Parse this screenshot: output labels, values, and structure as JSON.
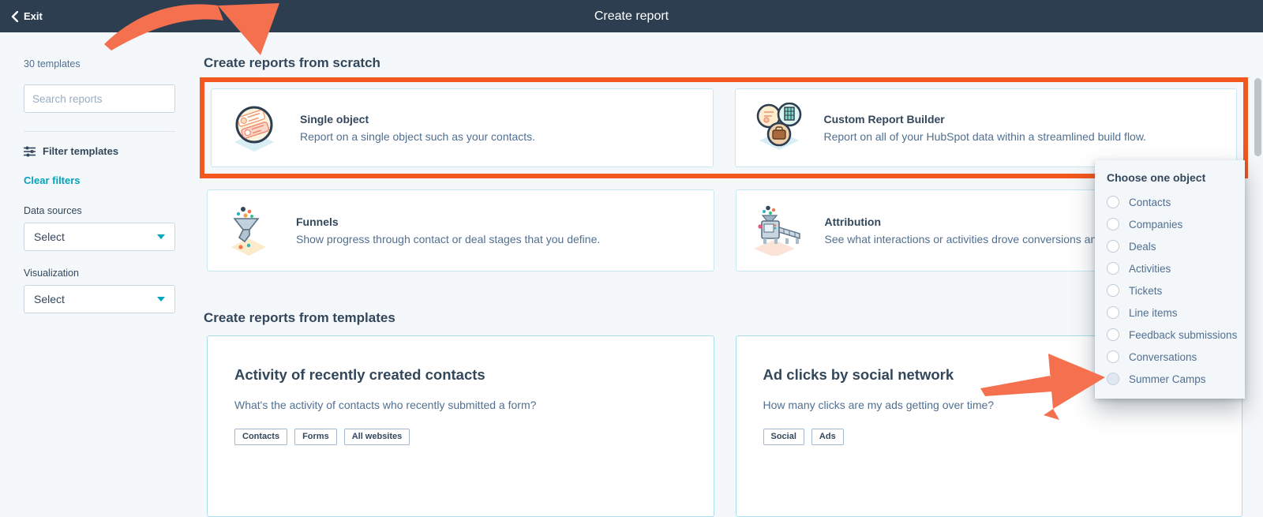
{
  "header": {
    "exit_label": "Exit",
    "title": "Create report"
  },
  "sidebar": {
    "template_count": "30 templates",
    "search_placeholder": "Search reports",
    "filter_templates_label": "Filter templates",
    "clear_filters_label": "Clear filters",
    "data_sources_label": "Data sources",
    "data_sources_value": "Select",
    "visualization_label": "Visualization",
    "visualization_value": "Select"
  },
  "scratch_section": {
    "heading": "Create reports from scratch",
    "cards": [
      {
        "title": "Single object",
        "description": "Report on a single object such as your contacts.",
        "icon": "single-object-illustration"
      },
      {
        "title": "Custom Report Builder",
        "description": "Report on all of your HubSpot data within a streamlined build flow.",
        "icon": "custom-report-builder-illustration"
      },
      {
        "title": "Funnels",
        "description": "Show progress through contact or deal stages that you define.",
        "icon": "funnels-illustration"
      },
      {
        "title": "Attribution",
        "description": "See what interactions or activities drove conversions an",
        "icon": "attribution-illustration"
      }
    ]
  },
  "templates_section": {
    "heading": "Create reports from templates",
    "cards": [
      {
        "title": "Activity of recently created contacts",
        "description": "What's the activity of contacts who recently submitted a form?",
        "tags": [
          "Contacts",
          "Forms",
          "All websites"
        ]
      },
      {
        "title": "Ad clicks by social network",
        "description": "How many clicks are my ads getting over time?",
        "tags": [
          "Social",
          "Ads"
        ]
      }
    ]
  },
  "object_dropdown": {
    "heading": "Choose one object",
    "options": [
      "Contacts",
      "Companies",
      "Deals",
      "Activities",
      "Tickets",
      "Line items",
      "Feedback submissions",
      "Conversations",
      "Summer Camps"
    ]
  },
  "annotations": {
    "arrow_top": "hand-drawn arrow pointing at highlighted scratch cards",
    "arrow_right": "hand-drawn arrow pointing at Summer Camps option"
  },
  "colors": {
    "header_bg": "#2d3e50",
    "accent_teal": "#00a4bd",
    "highlight_orange": "#f2571d",
    "arrow_coral": "#f4704f",
    "navy_text": "#33475b",
    "muted_text": "#516f90",
    "page_bg": "#f5f8fa"
  }
}
